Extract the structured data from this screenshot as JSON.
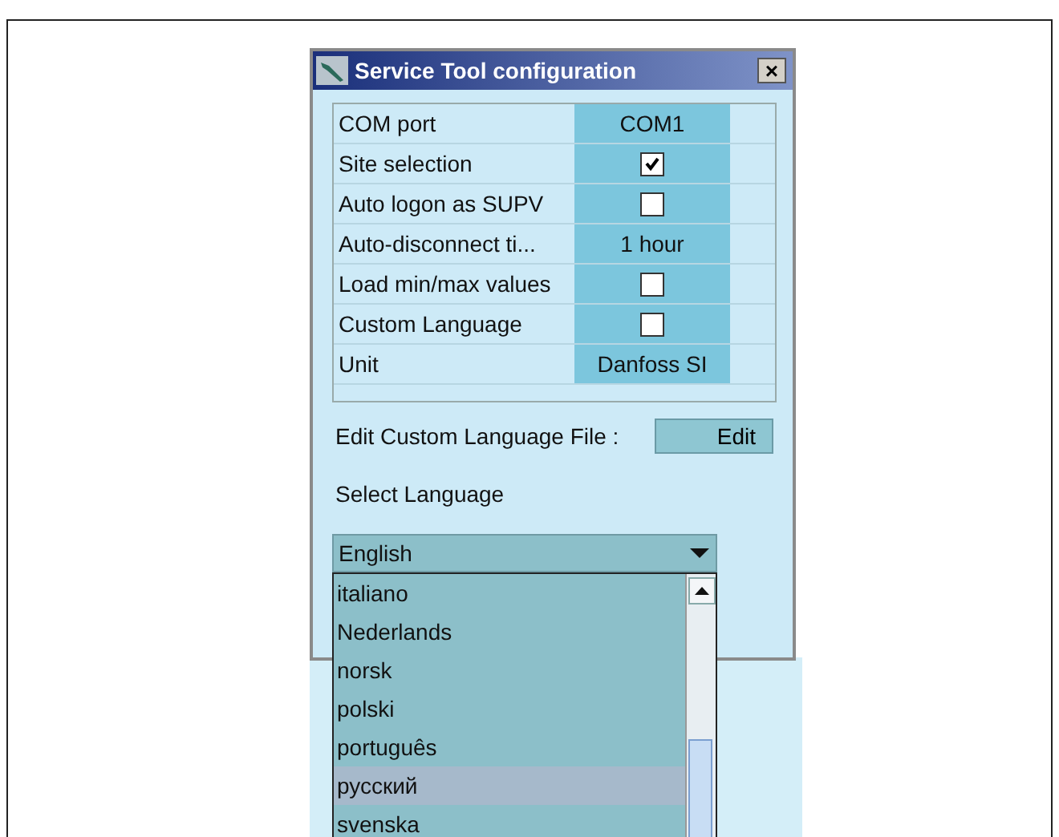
{
  "window": {
    "title": "Service Tool configuration",
    "close": "×"
  },
  "settings": [
    {
      "label": "COM port",
      "kind": "text",
      "value": "COM1"
    },
    {
      "label": "Site selection",
      "kind": "checkbox",
      "checked": true
    },
    {
      "label": "Auto logon as SUPV",
      "kind": "checkbox",
      "checked": false
    },
    {
      "label": "Auto-disconnect ti...",
      "kind": "text",
      "value": "1 hour"
    },
    {
      "label": "Load min/max values",
      "kind": "checkbox",
      "checked": false
    },
    {
      "label": "Custom Language",
      "kind": "checkbox",
      "checked": false
    },
    {
      "label": "Unit",
      "kind": "text",
      "value": "Danfoss SI"
    }
  ],
  "custom_language": {
    "label": "Edit Custom Language File :",
    "button": "Edit"
  },
  "language": {
    "label": "Select Language",
    "value": "English",
    "options": [
      {
        "label": "italiano",
        "selected": false
      },
      {
        "label": "Nederlands",
        "selected": false
      },
      {
        "label": "norsk",
        "selected": false
      },
      {
        "label": "polski",
        "selected": false
      },
      {
        "label": "português",
        "selected": false
      },
      {
        "label": "русский",
        "selected": true
      },
      {
        "label": "svenska",
        "selected": false
      }
    ]
  }
}
